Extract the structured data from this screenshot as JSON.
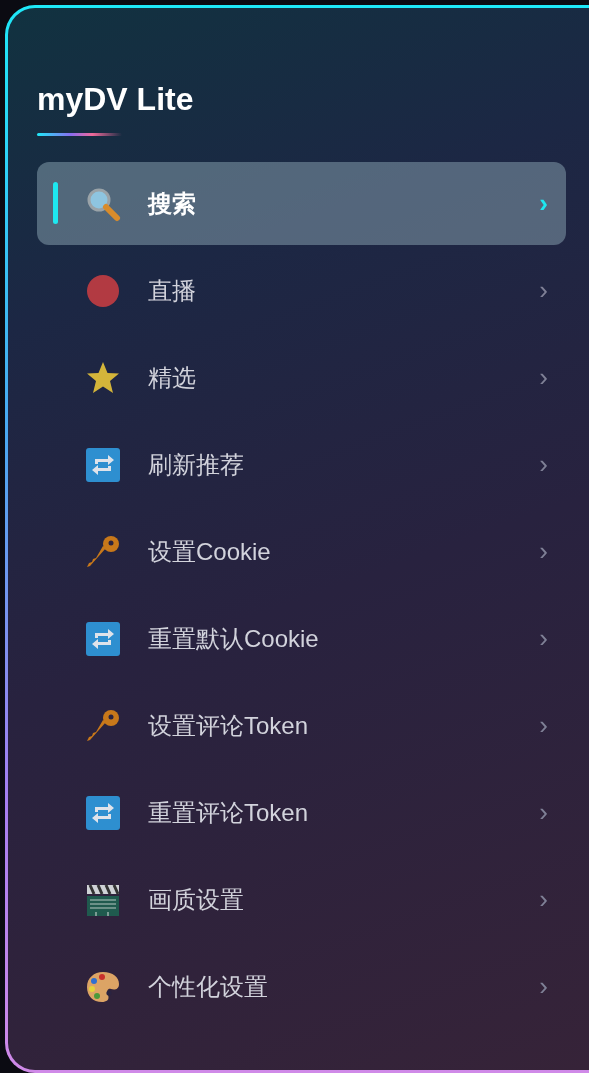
{
  "app": {
    "title": "myDV Lite"
  },
  "menu": [
    {
      "label": "搜索",
      "kind": "search",
      "chevron": "›",
      "selected": true
    },
    {
      "label": "直播",
      "kind": "dot",
      "chevron": "›",
      "selected": false
    },
    {
      "label": "精选",
      "kind": "star",
      "chevron": "›",
      "selected": false
    },
    {
      "label": "刷新推荐",
      "kind": "repeat",
      "chevron": "›",
      "selected": false
    },
    {
      "label": "设置Cookie",
      "kind": "key",
      "chevron": "›",
      "selected": false
    },
    {
      "label": "重置默认Cookie",
      "kind": "repeat",
      "chevron": "›",
      "selected": false
    },
    {
      "label": "设置评论Token",
      "kind": "key",
      "chevron": "›",
      "selected": false
    },
    {
      "label": "重置评论Token",
      "kind": "repeat",
      "chevron": "›",
      "selected": false
    },
    {
      "label": "画质设置",
      "kind": "clapper",
      "chevron": "›",
      "selected": false
    },
    {
      "label": "个性化设置",
      "kind": "palette",
      "chevron": "›",
      "selected": false
    }
  ]
}
